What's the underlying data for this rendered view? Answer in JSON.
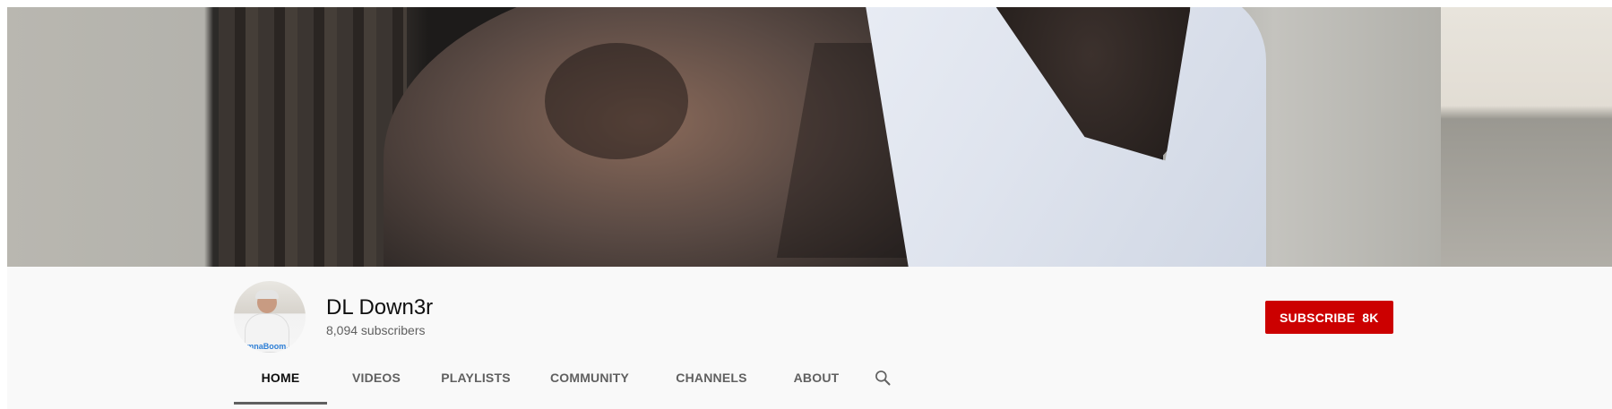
{
  "channel": {
    "name": "DL Down3r",
    "subscribers": "8,094 subscribers",
    "avatar_text": "mnaBoom..."
  },
  "subscribe": {
    "label": "SUBSCRIBE",
    "count": "8K",
    "color": "#cc0000"
  },
  "tabs": [
    {
      "label": "HOME",
      "active": true
    },
    {
      "label": "VIDEOS",
      "active": false
    },
    {
      "label": "PLAYLISTS",
      "active": false
    },
    {
      "label": "COMMUNITY",
      "active": false
    },
    {
      "label": "CHANNELS",
      "active": false
    },
    {
      "label": "ABOUT",
      "active": false
    }
  ],
  "icons": {
    "search": "search-icon"
  }
}
